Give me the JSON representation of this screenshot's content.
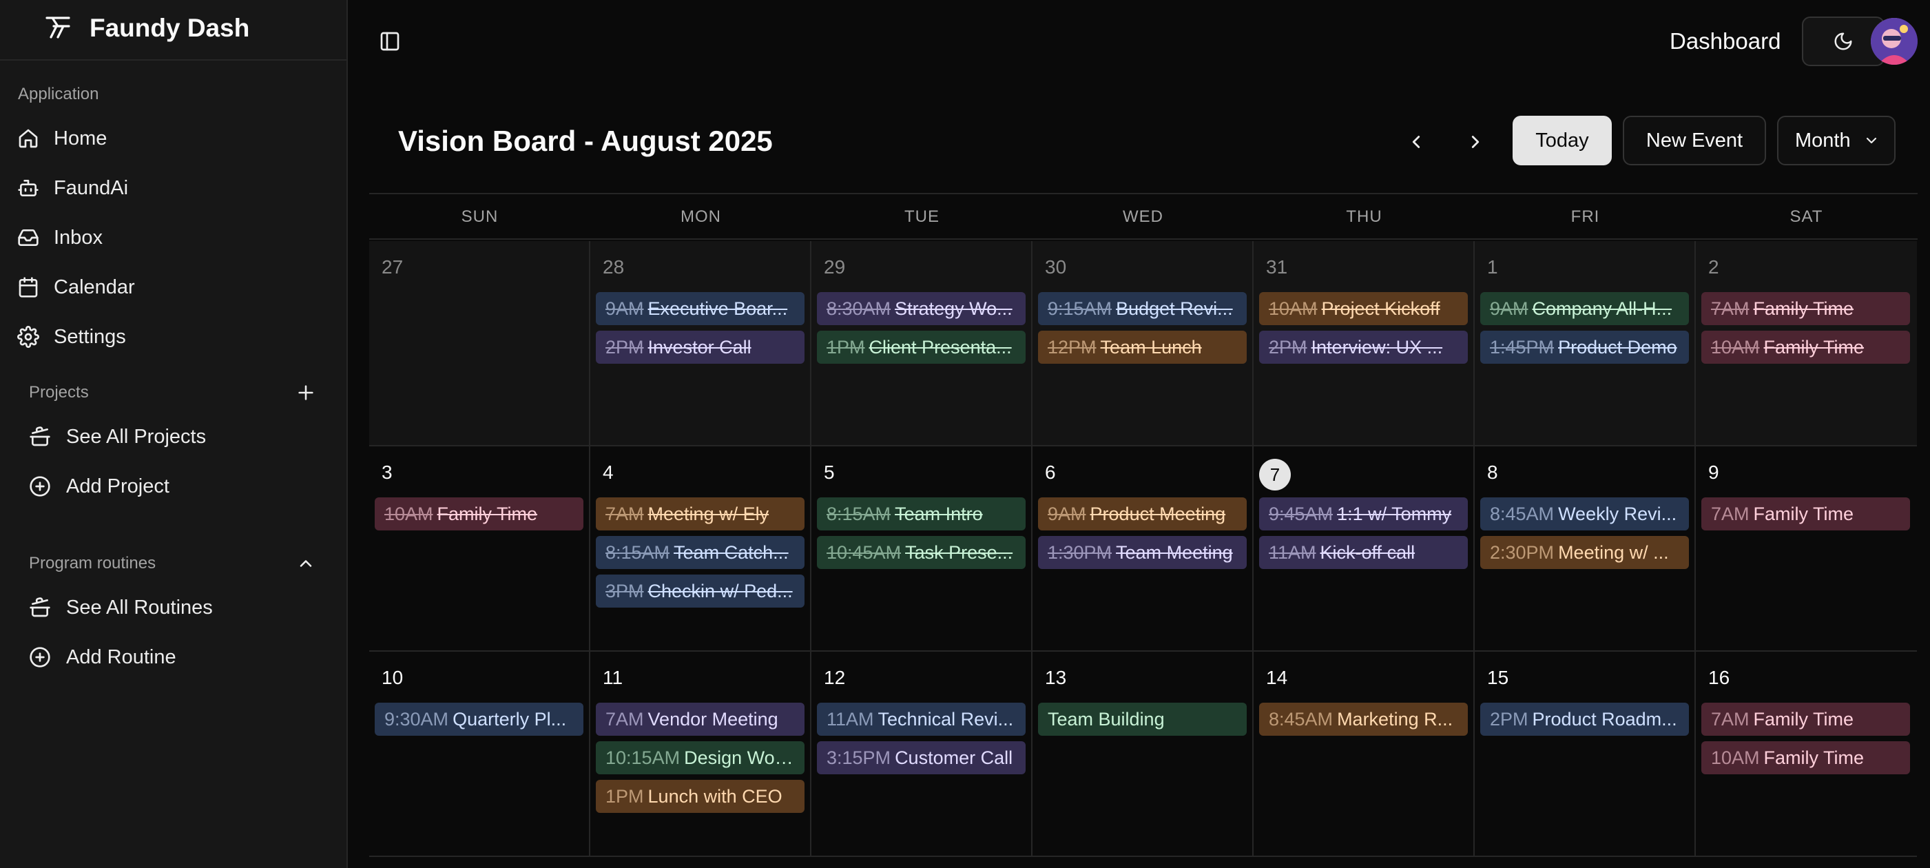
{
  "sidebar": {
    "brand": "Faundy Dash",
    "application_label": "Application",
    "nav": [
      {
        "label": "Home",
        "icon": "home-icon"
      },
      {
        "label": "FaundAi",
        "icon": "bot-icon"
      },
      {
        "label": "Inbox",
        "icon": "inbox-icon"
      },
      {
        "label": "Calendar",
        "icon": "calendar-icon"
      },
      {
        "label": "Settings",
        "icon": "gear-icon"
      }
    ],
    "projects_label": "Projects",
    "projects": [
      {
        "label": "See All Projects",
        "icon": "cooking-pot-icon"
      },
      {
        "label": "Add Project",
        "icon": "plus-circle-icon"
      }
    ],
    "routines_label": "Program routines",
    "routines": [
      {
        "label": "See All Routines",
        "icon": "cooking-pot-icon"
      },
      {
        "label": "Add Routine",
        "icon": "plus-circle-icon"
      }
    ]
  },
  "header": {
    "title": "Dashboard"
  },
  "calendar": {
    "title": "Vision Board - August 2025",
    "today_label": "Today",
    "new_event_label": "New Event",
    "view_label": "Month",
    "weekdays": [
      "SUN",
      "MON",
      "TUE",
      "WED",
      "THU",
      "FRI",
      "SAT"
    ],
    "weeks": [
      [
        {
          "day": "27",
          "out": true,
          "events": []
        },
        {
          "day": "28",
          "out": true,
          "events": [
            {
              "time": "9AM",
              "title": "Executive Boar...",
              "color": "blue",
              "done": true
            },
            {
              "time": "2PM",
              "title": "Investor Call",
              "color": "purple",
              "done": true
            }
          ]
        },
        {
          "day": "29",
          "out": true,
          "events": [
            {
              "time": "8:30AM",
              "title": "Strategy Wo...",
              "color": "purple",
              "done": true
            },
            {
              "time": "1PM",
              "title": "Client Presenta...",
              "color": "green",
              "done": true
            }
          ]
        },
        {
          "day": "30",
          "out": true,
          "events": [
            {
              "time": "9:15AM",
              "title": "Budget Revi...",
              "color": "blue",
              "done": true
            },
            {
              "time": "12PM",
              "title": "Team Lunch",
              "color": "orange",
              "done": true
            }
          ]
        },
        {
          "day": "31",
          "out": true,
          "events": [
            {
              "time": "10AM",
              "title": "Project Kickoff",
              "color": "orange",
              "done": true
            },
            {
              "time": "2PM",
              "title": "Interview: UX ...",
              "color": "purple",
              "done": true
            }
          ]
        },
        {
          "day": "1",
          "out": true,
          "events": [
            {
              "time": "9AM",
              "title": "Company All-H...",
              "color": "green",
              "done": true
            },
            {
              "time": "1:45PM",
              "title": "Product Demo",
              "color": "blue",
              "done": true
            }
          ]
        },
        {
          "day": "2",
          "out": true,
          "events": [
            {
              "time": "7AM",
              "title": "Family Time",
              "color": "red",
              "done": true
            },
            {
              "time": "10AM",
              "title": "Family Time",
              "color": "red",
              "done": true
            }
          ]
        }
      ],
      [
        {
          "day": "3",
          "out": false,
          "events": [
            {
              "time": "10AM",
              "title": "Family Time",
              "color": "red",
              "done": true
            }
          ]
        },
        {
          "day": "4",
          "out": false,
          "events": [
            {
              "time": "7AM",
              "title": "Meeting w/ Ely",
              "color": "orange",
              "done": true
            },
            {
              "time": "8:15AM",
              "title": "Team Catch...",
              "color": "blue",
              "done": true
            },
            {
              "time": "3PM",
              "title": "Checkin w/ Ped...",
              "color": "blue",
              "done": true
            }
          ]
        },
        {
          "day": "5",
          "out": false,
          "events": [
            {
              "time": "8:15AM",
              "title": "Team Intro",
              "color": "green",
              "done": true
            },
            {
              "time": "10:45AM",
              "title": "Task Prese...",
              "color": "green",
              "done": true
            }
          ]
        },
        {
          "day": "6",
          "out": false,
          "events": [
            {
              "time": "9AM",
              "title": "Product Meeting",
              "color": "orange",
              "done": true
            },
            {
              "time": "1:30PM",
              "title": "Team Meeting",
              "color": "purple",
              "done": true
            }
          ]
        },
        {
          "day": "7",
          "out": false,
          "today": true,
          "events": [
            {
              "time": "9:45AM",
              "title": "1:1 w/ Tommy",
              "color": "purple",
              "done": true
            },
            {
              "time": "11AM",
              "title": "Kick-off call",
              "color": "purple",
              "done": true
            }
          ]
        },
        {
          "day": "8",
          "out": false,
          "events": [
            {
              "time": "8:45AM",
              "title": "Weekly Revi...",
              "color": "blue",
              "done": false
            },
            {
              "time": "2:30PM",
              "title": "Meeting w/ ...",
              "color": "orange",
              "done": false
            }
          ]
        },
        {
          "day": "9",
          "out": false,
          "events": [
            {
              "time": "7AM",
              "title": "Family Time",
              "color": "red",
              "done": false
            }
          ]
        }
      ],
      [
        {
          "day": "10",
          "out": false,
          "events": [
            {
              "time": "9:30AM",
              "title": "Quarterly Pl...",
              "color": "blue",
              "done": false
            }
          ]
        },
        {
          "day": "11",
          "out": false,
          "events": [
            {
              "time": "7AM",
              "title": "Vendor Meeting",
              "color": "purple",
              "done": false
            },
            {
              "time": "10:15AM",
              "title": "Design Wor...",
              "color": "green",
              "done": false
            },
            {
              "time": "1PM",
              "title": "Lunch with CEO",
              "color": "orange",
              "done": false
            }
          ]
        },
        {
          "day": "12",
          "out": false,
          "events": [
            {
              "time": "11AM",
              "title": "Technical Revi...",
              "color": "blue",
              "done": false
            },
            {
              "time": "3:15PM",
              "title": "Customer Call",
              "color": "purple",
              "done": false
            }
          ]
        },
        {
          "day": "13",
          "out": false,
          "events": [
            {
              "time": "",
              "title": "Team Building",
              "color": "green",
              "done": false
            }
          ]
        },
        {
          "day": "14",
          "out": false,
          "events": [
            {
              "time": "8:45AM",
              "title": "Marketing R...",
              "color": "orange",
              "done": false
            }
          ]
        },
        {
          "day": "15",
          "out": false,
          "events": [
            {
              "time": "2PM",
              "title": "Product Roadm...",
              "color": "blue",
              "done": false
            }
          ]
        },
        {
          "day": "16",
          "out": false,
          "events": [
            {
              "time": "7AM",
              "title": "Family Time",
              "color": "red",
              "done": false
            },
            {
              "time": "10AM",
              "title": "Family Time",
              "color": "red",
              "done": false
            }
          ]
        }
      ]
    ]
  }
}
